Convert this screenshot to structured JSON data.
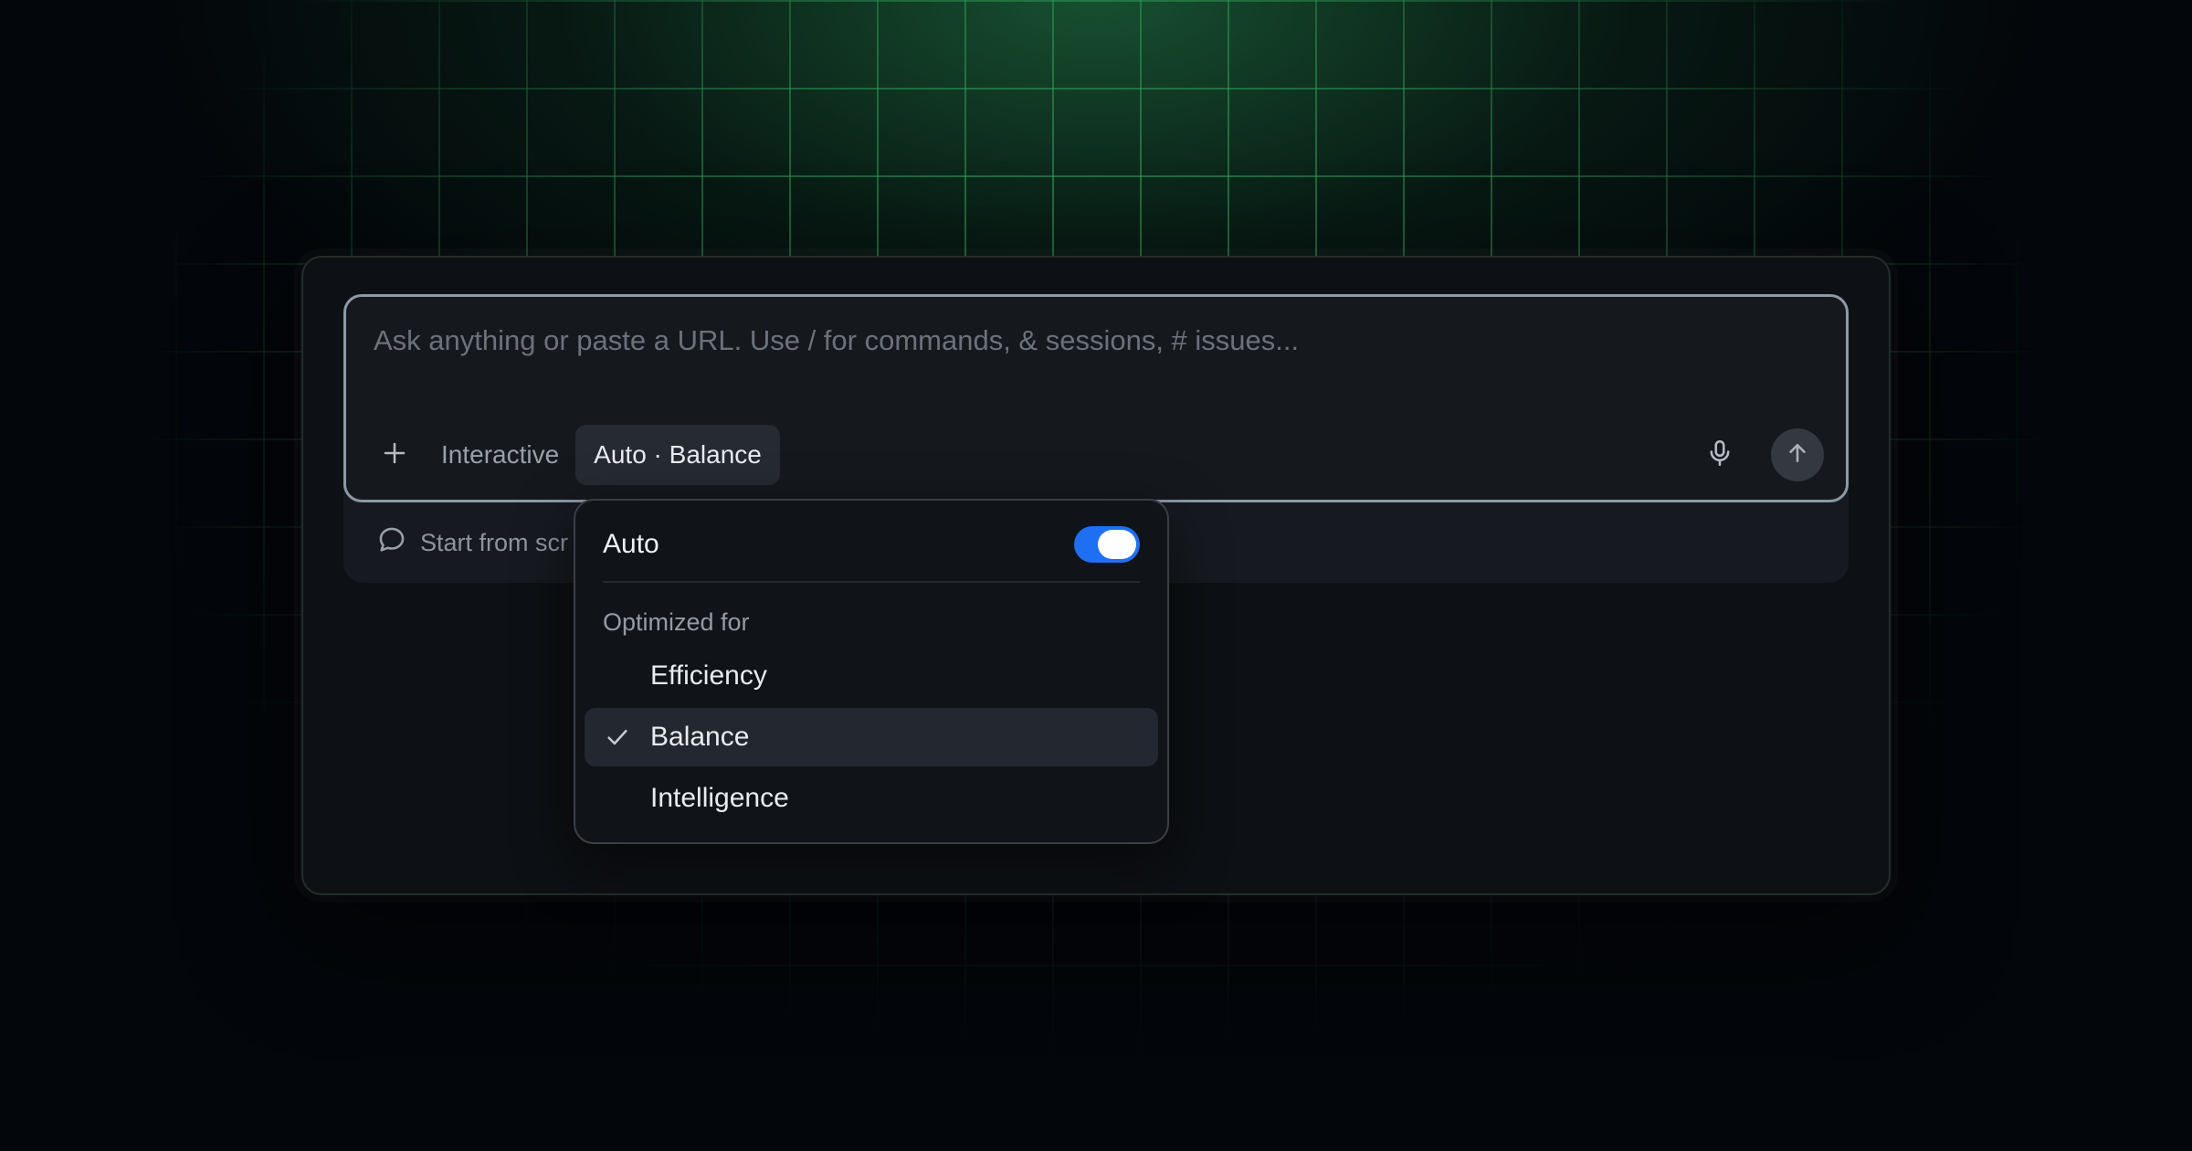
{
  "composer": {
    "placeholder": "Ask anything or paste a URL. Use / for commands, & sessions, # issues...",
    "mode_label": "Interactive",
    "model_chip_label": "Auto · Balance",
    "icons": {
      "add": "plus-icon",
      "mic": "microphone-icon",
      "send": "arrow-up-icon"
    }
  },
  "suggestion": {
    "label": "Start from scr",
    "icon": "chat-bubble-icon"
  },
  "model_menu": {
    "auto_label": "Auto",
    "auto_enabled": true,
    "section_label": "Optimized for",
    "options": [
      {
        "label": "Efficiency",
        "selected": false
      },
      {
        "label": "Balance",
        "selected": true
      },
      {
        "label": "Intelligence",
        "selected": false
      }
    ],
    "check_icon": "checkmark-icon"
  },
  "colors": {
    "accent_toggle": "#1f6ff2",
    "grid_green": "#3cbe69",
    "background": "#03060a"
  }
}
